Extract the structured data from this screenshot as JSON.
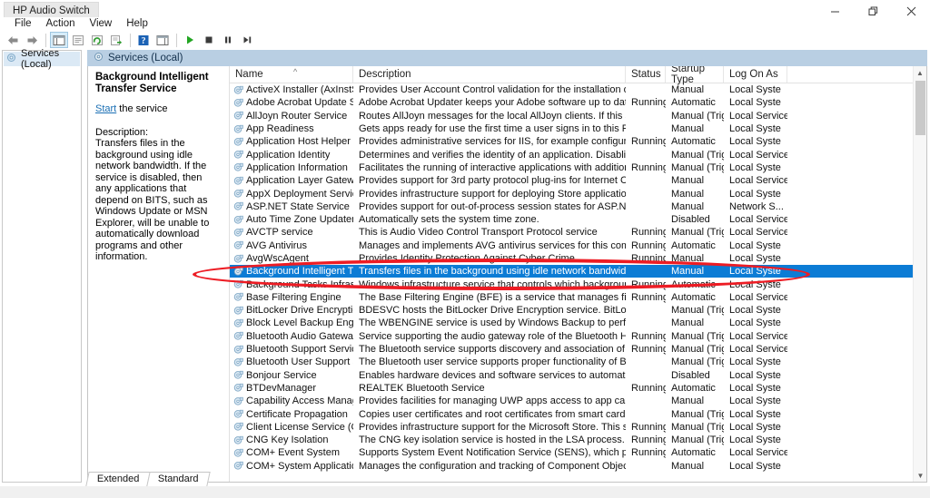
{
  "window": {
    "title": "HP Audio Switch",
    "controls": [
      {
        "name": "minimize",
        "glyph": "minimize-icon"
      },
      {
        "name": "restore",
        "glyph": "restore-icon"
      },
      {
        "name": "close",
        "glyph": "close-icon"
      }
    ]
  },
  "menubar": [
    "File",
    "Action",
    "View",
    "Help"
  ],
  "toolbar": [
    {
      "name": "back",
      "icon": "back-arrow-icon"
    },
    {
      "name": "forward",
      "icon": "forward-arrow-icon"
    },
    {
      "name": "separator",
      "icon": "separator"
    },
    {
      "name": "show-hide-console-tree",
      "icon": "console-tree-icon",
      "active": true
    },
    {
      "name": "properties",
      "icon": "properties-icon"
    },
    {
      "name": "refresh",
      "icon": "refresh-icon"
    },
    {
      "name": "export-list",
      "icon": "export-list-icon"
    },
    {
      "name": "separator",
      "icon": "separator"
    },
    {
      "name": "help",
      "icon": "help-icon"
    },
    {
      "name": "show-hide-action-pane",
      "icon": "action-pane-icon"
    },
    {
      "name": "separator",
      "icon": "separator"
    },
    {
      "name": "start-service",
      "icon": "play-icon"
    },
    {
      "name": "stop-service",
      "icon": "stop-icon"
    },
    {
      "name": "pause-service",
      "icon": "pause-icon"
    },
    {
      "name": "restart-service",
      "icon": "restart-icon"
    }
  ],
  "tree": {
    "root_label": "Services (Local)"
  },
  "pane_tab": {
    "label": "Services (Local)"
  },
  "details": {
    "title": "Background Intelligent Transfer Service",
    "action_link": "Start",
    "action_suffix": " the service",
    "description_label": "Description:",
    "description": "Transfers files in the background using idle network bandwidth. If the service is disabled, then any applications that depend on BITS, such as Windows Update or MSN Explorer, will be unable to automatically download programs and other information."
  },
  "list": {
    "columns": [
      "Name",
      "Description",
      "Status",
      "Startup Type",
      "Log On As"
    ],
    "sort_indicator": "ascending",
    "rows": [
      {
        "name": "ActiveX Installer (AxInstSV)",
        "description": "Provides User Account Control validation for the installation of ActiveX c...",
        "status": "",
        "startup": "Manual",
        "logon": "Local Syste"
      },
      {
        "name": "Adobe Acrobat Update Serv",
        "description": "Adobe Acrobat Updater keeps your Adobe software up to date.",
        "status": "Running",
        "startup": "Automatic",
        "logon": "Local Syste"
      },
      {
        "name": "AllJoyn Router Service",
        "description": "Routes AllJoyn messages for the local AllJoyn clients. If this service is sto...",
        "status": "",
        "startup": "Manual (Trig...",
        "logon": "Local Service"
      },
      {
        "name": "App Readiness",
        "description": "Gets apps ready for use the first time a user signs in to this PC and when ...",
        "status": "",
        "startup": "Manual",
        "logon": "Local Syste"
      },
      {
        "name": "Application Host Helper Ser...",
        "description": "Provides administrative services for IIS, for example configuration history...",
        "status": "Running",
        "startup": "Automatic",
        "logon": "Local Syste"
      },
      {
        "name": "Application Identity",
        "description": "Determines and verifies the identity of an application. Disabling this servi...",
        "status": "",
        "startup": "Manual (Trig...",
        "logon": "Local Service"
      },
      {
        "name": "Application Information",
        "description": "Facilitates the running of interactive applications with additional adminis...",
        "status": "Running",
        "startup": "Manual (Trig...",
        "logon": "Local Syste"
      },
      {
        "name": "Application Layer Gateway ...",
        "description": "Provides support for 3rd party protocol plug-ins for Internet Connection ...",
        "status": "",
        "startup": "Manual",
        "logon": "Local Service"
      },
      {
        "name": "AppX Deployment Service (...",
        "description": "Provides infrastructure support for deploying Store applications. This ser...",
        "status": "",
        "startup": "Manual",
        "logon": "Local Syste"
      },
      {
        "name": "ASP.NET State Service",
        "description": "Provides support for out-of-process session states for ASP.NET. If this ser...",
        "status": "",
        "startup": "Manual",
        "logon": "Network S..."
      },
      {
        "name": "Auto Time Zone Updater",
        "description": "Automatically sets the system time zone.",
        "status": "",
        "startup": "Disabled",
        "logon": "Local Service"
      },
      {
        "name": "AVCTP service",
        "description": "This is Audio Video Control Transport Protocol service",
        "status": "Running",
        "startup": "Manual (Trig...",
        "logon": "Local Service"
      },
      {
        "name": "AVG Antivirus",
        "description": "Manages and implements AVG antivirus services for this computer. This i...",
        "status": "Running",
        "startup": "Automatic",
        "logon": "Local Syste"
      },
      {
        "name": "AvgWscAgent",
        "description": "Provides Identity Protection Against Cyber Crime.",
        "status": "Running",
        "startup": "Manual",
        "logon": "Local Syste"
      },
      {
        "name": "Background Intelligent Tran...",
        "description": "Transfers files in the background using idle network bandwidth. If the ser...",
        "status": "",
        "startup": "Manual",
        "logon": "Local Syste",
        "selected": true
      },
      {
        "name": "Background Tasks Infrastru...",
        "description": "Windows infrastructure service that controls which background tasks ca...",
        "status": "Running",
        "startup": "Automatic",
        "logon": "Local Syste"
      },
      {
        "name": "Base Filtering Engine",
        "description": "The Base Filtering Engine (BFE) is a service that manages firewall and Inte...",
        "status": "Running",
        "startup": "Automatic",
        "logon": "Local Service"
      },
      {
        "name": "BitLocker Drive Encryption ...",
        "description": "BDESVC hosts the BitLocker Drive Encryption service. BitLocker Drive Enc...",
        "status": "",
        "startup": "Manual (Trig...",
        "logon": "Local Syste"
      },
      {
        "name": "Block Level Backup Engine ...",
        "description": "The WBENGINE service is used by Windows Backup to perform backup a...",
        "status": "",
        "startup": "Manual",
        "logon": "Local Syste"
      },
      {
        "name": "Bluetooth Audio Gateway S...",
        "description": "Service supporting the audio gateway role of the Bluetooth Handsfree Pr...",
        "status": "Running",
        "startup": "Manual (Trig...",
        "logon": "Local Service"
      },
      {
        "name": "Bluetooth Support Service",
        "description": "The Bluetooth service supports discovery and association of remote Blue...",
        "status": "Running",
        "startup": "Manual (Trig...",
        "logon": "Local Service"
      },
      {
        "name": "Bluetooth User Support Ser...",
        "description": "The Bluetooth user service supports proper functionality of Bluetooth fe...",
        "status": "",
        "startup": "Manual (Trig...",
        "logon": "Local Syste"
      },
      {
        "name": "Bonjour Service",
        "description": "Enables hardware devices and software services to automatically configu...",
        "status": "",
        "startup": "Disabled",
        "logon": "Local Syste"
      },
      {
        "name": "BTDevManager",
        "description": "REALTEK Bluetooth Service",
        "status": "Running",
        "startup": "Automatic",
        "logon": "Local Syste"
      },
      {
        "name": "Capability Access Manager ...",
        "description": "Provides facilities for managing UWP apps access to app capabilities as ...",
        "status": "",
        "startup": "Manual",
        "logon": "Local Syste"
      },
      {
        "name": "Certificate Propagation",
        "description": "Copies user certificates and root certificates from smart cards into the cu...",
        "status": "",
        "startup": "Manual (Trig...",
        "logon": "Local Syste"
      },
      {
        "name": "Client License Service (ClipS",
        "description": "Provides infrastructure support for the Microsoft Store. This service is sta...",
        "status": "Running",
        "startup": "Manual (Trig...",
        "logon": "Local Syste"
      },
      {
        "name": "CNG Key Isolation",
        "description": "The CNG key isolation service is hosted in the LSA process. The service p...",
        "status": "Running",
        "startup": "Manual (Trig...",
        "logon": "Local Syste"
      },
      {
        "name": "COM+ Event System",
        "description": "Supports System Event Notification Service (SENS), which provides auto...",
        "status": "Running",
        "startup": "Automatic",
        "logon": "Local Service"
      },
      {
        "name": "COM+ System Application",
        "description": "Manages the configuration and tracking of Component Object Model (C...",
        "status": "",
        "startup": "Manual",
        "logon": "Local Syste"
      }
    ]
  },
  "bottom_tabs": [
    {
      "label": "Extended",
      "active": false
    },
    {
      "label": "Standard",
      "active": true
    }
  ],
  "annotation": {
    "shape": "ellipse",
    "color": "#ed1c24",
    "target_row": "Background Intelligent Tran..."
  },
  "colors": {
    "selection": "#0c7cd5",
    "annotation": "#ed1c24",
    "tab_header": "#b9cfe3",
    "link": "#1a6fb4"
  }
}
